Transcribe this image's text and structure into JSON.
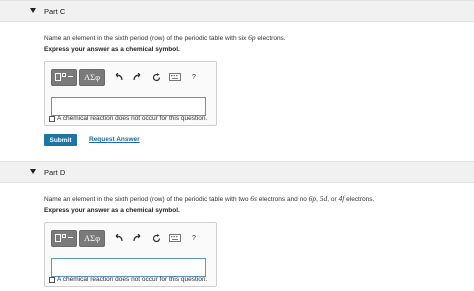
{
  "part_c": {
    "title": "Part C",
    "question_prefix": "Name an element in the sixth period (row) of the periodic table with six ",
    "question_term": "6p",
    "question_suffix": " electrons.",
    "instruction": "Express your answer as a chemical symbol.",
    "greek_label": "ΑΣφ",
    "help_label": "?",
    "answer_value": "",
    "no_reaction_label": "A chemical reaction does not occur for this question.",
    "submit_label": "Submit",
    "request_label": "Request Answer"
  },
  "part_d": {
    "title": "Part D",
    "q1": "Name an element in the sixth period (row) of the periodic table with two ",
    "t1": "6s",
    "q2": " electrons and no ",
    "t2": "6p",
    "q3": ", ",
    "t3": "5d",
    "q4": ", or ",
    "t4": "4f",
    "q5": " electrons.",
    "instruction": "Express your answer as a chemical symbol.",
    "greek_label": "ΑΣφ",
    "help_label": "?",
    "answer_value": "",
    "no_reaction_label": "A chemical reaction does not occur for this question."
  },
  "icons": [
    "caret-down",
    "template",
    "undo",
    "redo",
    "reset",
    "keyboard",
    "help"
  ]
}
